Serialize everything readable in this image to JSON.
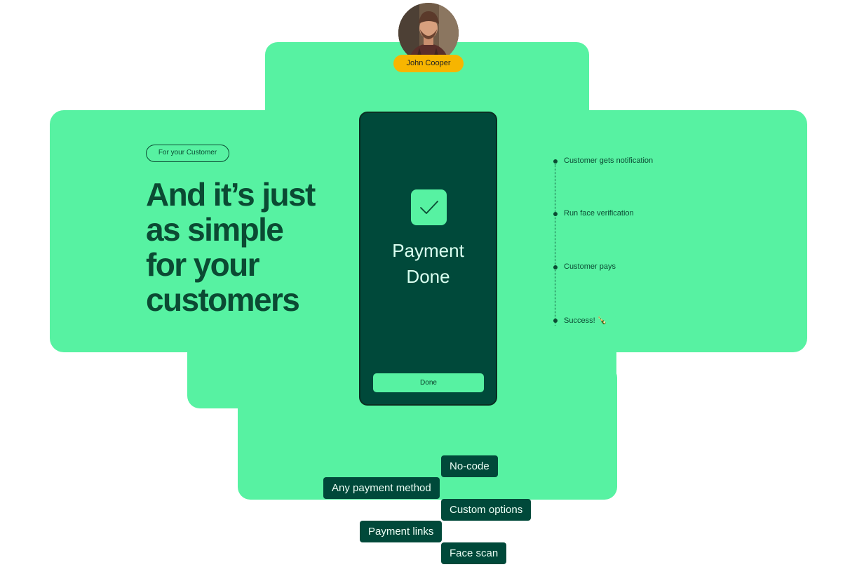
{
  "profile": {
    "name": "John Cooper"
  },
  "badge": {
    "label": "For your Customer"
  },
  "headline": {
    "line1": "And it’s just",
    "line2": "as simple",
    "line3": "for your",
    "line4": "customers"
  },
  "phone": {
    "title_line1": "Payment",
    "title_line2": "Done",
    "button_label": "Done"
  },
  "steps": [
    {
      "label": "Customer gets notification"
    },
    {
      "label": "Run face verification"
    },
    {
      "label": "Customer pays"
    },
    {
      "label": "Success! 🍾"
    }
  ],
  "features": [
    {
      "label": "No-code"
    },
    {
      "label": "Any payment method"
    },
    {
      "label": "Custom options"
    },
    {
      "label": "Payment links"
    },
    {
      "label": "Face scan"
    }
  ],
  "colors": {
    "brand_green": "#57f2a2",
    "dark_green": "#00493a",
    "text_green": "#0b4a33",
    "name_pill": "#f7b500"
  },
  "icons": {
    "success": "check-icon"
  }
}
